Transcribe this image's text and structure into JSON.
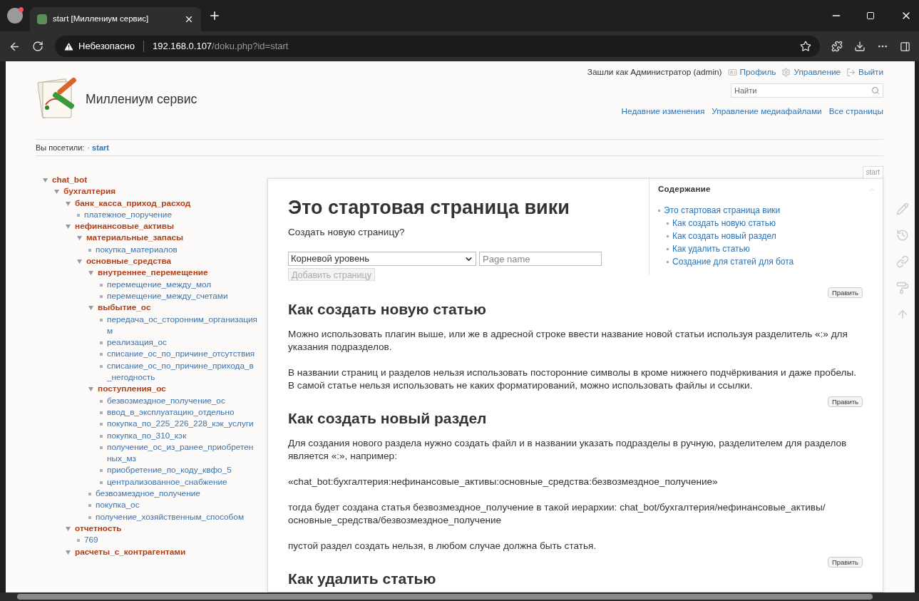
{
  "browser": {
    "tab": {
      "title": "start [Миллениум сервис]",
      "selected": true
    },
    "address_bar": {
      "security_label": "Небезопасно",
      "host": "192.168.0.107",
      "path": "/doku.php?id=start"
    }
  },
  "header": {
    "site_title": "Миллениум сервис",
    "user_info": "Зашли как Администратор (admin)",
    "user_links": [
      {
        "text": "Профиль",
        "kind": "profile"
      },
      {
        "text": "Управление",
        "kind": "admin"
      },
      {
        "text": "Выйти",
        "kind": "logout"
      }
    ],
    "search": {
      "placeholder": "Найти"
    },
    "nav_links": [
      "Недавние изменения",
      "Управление медиафайлами",
      "Все страницы"
    ]
  },
  "breadcrumb": {
    "label": "Вы посетили:",
    "separator": "·",
    "items": [
      "start"
    ]
  },
  "sidebar_tree": [
    {
      "text": "chat_bot",
      "kind": "namespace",
      "expanded": true,
      "children": [
        {
          "text": "бухгалтерия",
          "kind": "namespace",
          "expanded": true,
          "children": [
            {
              "text": "банк_касса_приход_расход",
              "kind": "namespace",
              "expanded": true,
              "children": [
                {
                  "text": "платежное_поручение",
                  "kind": "page"
                }
              ]
            },
            {
              "text": "нефинансовые_активы",
              "kind": "namespace",
              "expanded": true,
              "children": [
                {
                  "text": "материальные_запасы",
                  "kind": "namespace",
                  "expanded": true,
                  "children": [
                    {
                      "text": "покупка_материалов",
                      "kind": "page"
                    }
                  ]
                },
                {
                  "text": "основные_средства",
                  "kind": "namespace",
                  "expanded": true,
                  "children": [
                    {
                      "text": "внутреннее_перемещение",
                      "kind": "namespace",
                      "expanded": true,
                      "children": [
                        {
                          "text": "перемещение_между_мол",
                          "kind": "page"
                        },
                        {
                          "text": "перемещение_между_счетами",
                          "kind": "page"
                        }
                      ]
                    },
                    {
                      "text": "выбытие_ос",
                      "kind": "namespace",
                      "expanded": true,
                      "children": [
                        {
                          "text": "передача_ос_сторонним_организациям",
                          "kind": "page"
                        },
                        {
                          "text": "реализация_ос",
                          "kind": "page"
                        },
                        {
                          "text": "списание_ос_по_причине_отсутствия",
                          "kind": "page"
                        },
                        {
                          "text": "списание_ос_по_причине_прихода_в_негодность",
                          "kind": "page"
                        }
                      ]
                    },
                    {
                      "text": "поступления_ос",
                      "kind": "namespace",
                      "expanded": true,
                      "children": [
                        {
                          "text": "безвозмездное_получение_ос",
                          "kind": "page"
                        },
                        {
                          "text": "ввод_в_эксплуатацию_отдельно",
                          "kind": "page"
                        },
                        {
                          "text": "покупка_по_225_226_228_кэк_услуги",
                          "kind": "page"
                        },
                        {
                          "text": "покупка_по_310_кэк",
                          "kind": "page"
                        },
                        {
                          "text": "получение_ос_из_ранее_приобретенных_мз",
                          "kind": "page"
                        },
                        {
                          "text": "приобретение_по_коду_квфо_5",
                          "kind": "page"
                        },
                        {
                          "text": "централизованное_снабжение",
                          "kind": "page"
                        }
                      ]
                    },
                    {
                      "text": "безвозмездное_получение",
                      "kind": "page"
                    },
                    {
                      "text": "покупка_ос",
                      "kind": "page"
                    },
                    {
                      "text": "получение_хозяйственным_способом",
                      "kind": "page"
                    }
                  ]
                }
              ]
            },
            {
              "text": "отчетность",
              "kind": "namespace",
              "expanded": true,
              "children": [
                {
                  "text": "769",
                  "kind": "page"
                }
              ]
            },
            {
              "text": "расчеты_с_контрагентами",
              "kind": "namespace",
              "expanded": true
            }
          ]
        }
      ]
    }
  ],
  "page": {
    "page_id": "start",
    "toc": {
      "title": "Содержание",
      "expanded": true,
      "items": [
        {
          "text": "Это стартовая страница вики",
          "children": [
            {
              "text": "Как создать новую статью"
            },
            {
              "text": "Как создать новый раздел"
            },
            {
              "text": "Как удалить статью"
            },
            {
              "text": "Создание для статей для бота"
            }
          ]
        }
      ]
    },
    "blocks": [
      {
        "kind": "h1",
        "text": "Это стартовая страница вики"
      },
      {
        "kind": "paragraph",
        "text": "Создать новую страницу?"
      },
      {
        "kind": "form",
        "select_value": "Корневой уровень",
        "placeholder": "Page name",
        "button": "Добавить страницу",
        "disabled": true
      },
      {
        "kind": "edit",
        "text": "Править"
      },
      {
        "kind": "h2",
        "text": "Как создать новую статью"
      },
      {
        "kind": "paragraph",
        "text": "Можно использовать плагин выше, или же в адресной строке ввести название новой статьи используя разделитель «:» для указания подразделов."
      },
      {
        "kind": "paragraph",
        "text": "В названии страниц и разделов нельзя использовать посторонние символы в кроме нижнего подчёркивания и даже пробелы. В самой статье нельзя использовать не каких форматирований, можно использовать файлы и ссылки."
      },
      {
        "kind": "edit",
        "text": "Править"
      },
      {
        "kind": "h2",
        "text": "Как создать новый раздел"
      },
      {
        "kind": "paragraph",
        "text": "Для создания нового раздела нужно создать файл и в названии указать подразделы в ручную, разделителем для разделов является «:», например:"
      },
      {
        "kind": "paragraph",
        "text": "«chat_bot:бухгалтерия:нефинансовые_активы:основные_средства:безвозмездное_получение»"
      },
      {
        "kind": "paragraph",
        "text": "тогда будет создана статья безвозмездное_получение в такой иерархии: chat_bot/бухгалтерия/нефинансовые_активы/ основные_средства/безвозмездное_получение"
      },
      {
        "kind": "paragraph",
        "text": "пустой раздел создать нельзя, в любом случае должна быть статья."
      },
      {
        "kind": "edit",
        "text": "Править"
      },
      {
        "kind": "h2",
        "text": "Как удалить статью"
      }
    ]
  }
}
